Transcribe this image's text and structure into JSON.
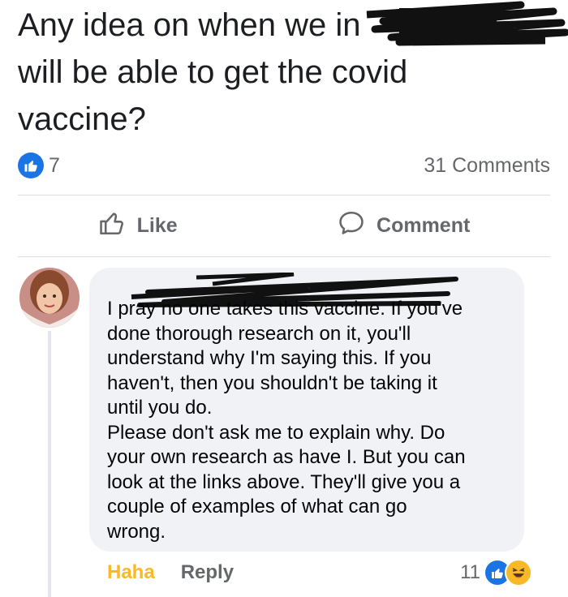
{
  "post": {
    "text": "Any idea on when we in\nwill be able to get the covid\nvaccine?"
  },
  "stats": {
    "like_count": "7",
    "comments_count": "31 Comments"
  },
  "actions": {
    "like_label": "Like",
    "comment_label": "Comment"
  },
  "comment": {
    "body": "I pray no one takes this vaccine. If you've\ndone thorough research on it, you'll\nunderstand why I'm saying this. If you\nhaven't, then you shouldn't be taking it\nuntil  you do.\nPlease don't ask me to explain why. Do\nyour own research as have I. But you can\nlook at the links above. They'll give you a\ncouple of examples of what can go\nwrong.",
    "haha_label": "Haha",
    "reply_label": "Reply",
    "reaction_count": "11"
  },
  "colors": {
    "like_blue": "#1b74e4",
    "haha_yellow": "#f7b928",
    "bubble_bg": "#f0f2f5",
    "secondary_text": "#65676b"
  },
  "icons": [
    "like-badge-icon",
    "thumbs-up-icon",
    "comment-icon",
    "like-reaction-icon",
    "haha-reaction-icon"
  ]
}
